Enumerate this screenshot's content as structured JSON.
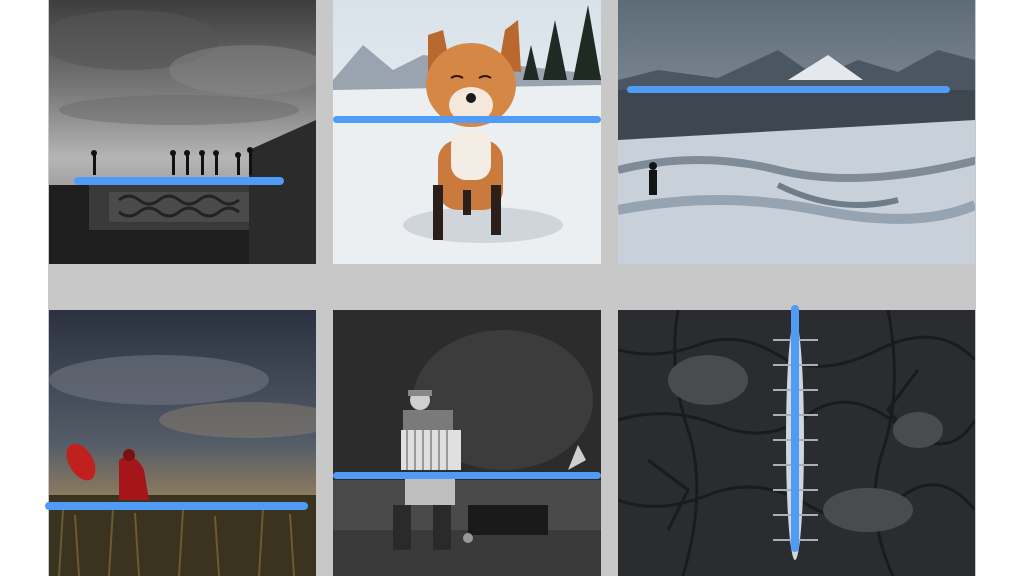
{
  "colors": {
    "background": "#ffffff",
    "grid_gap": "#c8c8c8",
    "stroke": "#4f9bf5"
  },
  "tiles": [
    {
      "subject": "silhouettes-on-wall"
    },
    {
      "subject": "fox-in-snow"
    },
    {
      "subject": "glacier-walker"
    },
    {
      "subject": "red-umbrella-field"
    },
    {
      "subject": "accordion-player"
    },
    {
      "subject": "rowing-boat-aerial"
    }
  ]
}
